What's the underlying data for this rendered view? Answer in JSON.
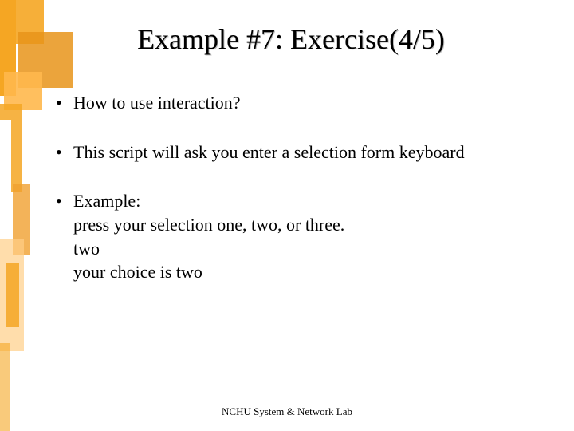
{
  "title": "Example #7: Exercise(4/5)",
  "bullets": [
    {
      "text": "How to use interaction?"
    },
    {
      "text": "This script will ask you enter a selection form keyboard"
    },
    {
      "text": "Example:",
      "sub": [
        "press your selection  one, two, or three.",
        "two",
        "your choice is two"
      ]
    }
  ],
  "footer": "NCHU System & Network Lab"
}
